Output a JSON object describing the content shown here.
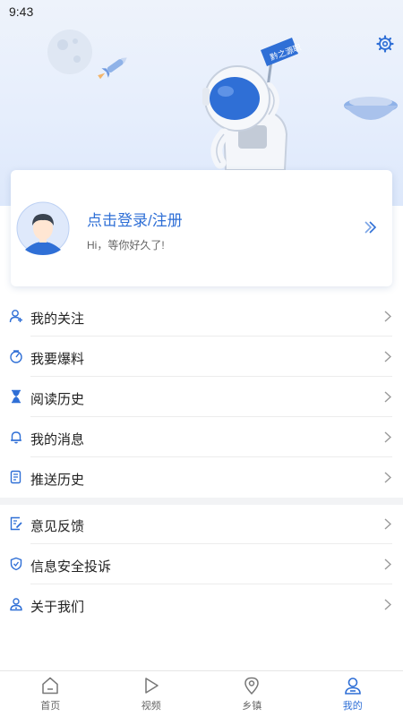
{
  "status_bar": {
    "time": "9:43"
  },
  "hero": {
    "flag_text": "黔之源职"
  },
  "profile": {
    "login_text": "点击登录/注册",
    "greeting": "Hi，等你好久了!"
  },
  "menu_group_1": [
    {
      "label": "我的关注",
      "icon": "user-follow-icon"
    },
    {
      "label": "我要爆料",
      "icon": "report-tip-icon"
    },
    {
      "label": "阅读历史",
      "icon": "hourglass-icon"
    },
    {
      "label": "我的消息",
      "icon": "bell-icon"
    },
    {
      "label": "推送历史",
      "icon": "push-history-icon"
    }
  ],
  "menu_group_2": [
    {
      "label": "意见反馈",
      "icon": "feedback-icon"
    },
    {
      "label": "信息安全投诉",
      "icon": "shield-icon"
    },
    {
      "label": "关于我们",
      "icon": "about-us-icon"
    }
  ],
  "tabbar": {
    "tabs": [
      {
        "label": "首页",
        "icon": "home-icon"
      },
      {
        "label": "视频",
        "icon": "play-icon"
      },
      {
        "label": "乡镇",
        "icon": "location-pin-icon"
      },
      {
        "label": "我的",
        "icon": "profile-icon",
        "active": true
      }
    ]
  },
  "colors": {
    "accent": "#2f6fd6",
    "text": "#222222",
    "muted": "#666666"
  }
}
